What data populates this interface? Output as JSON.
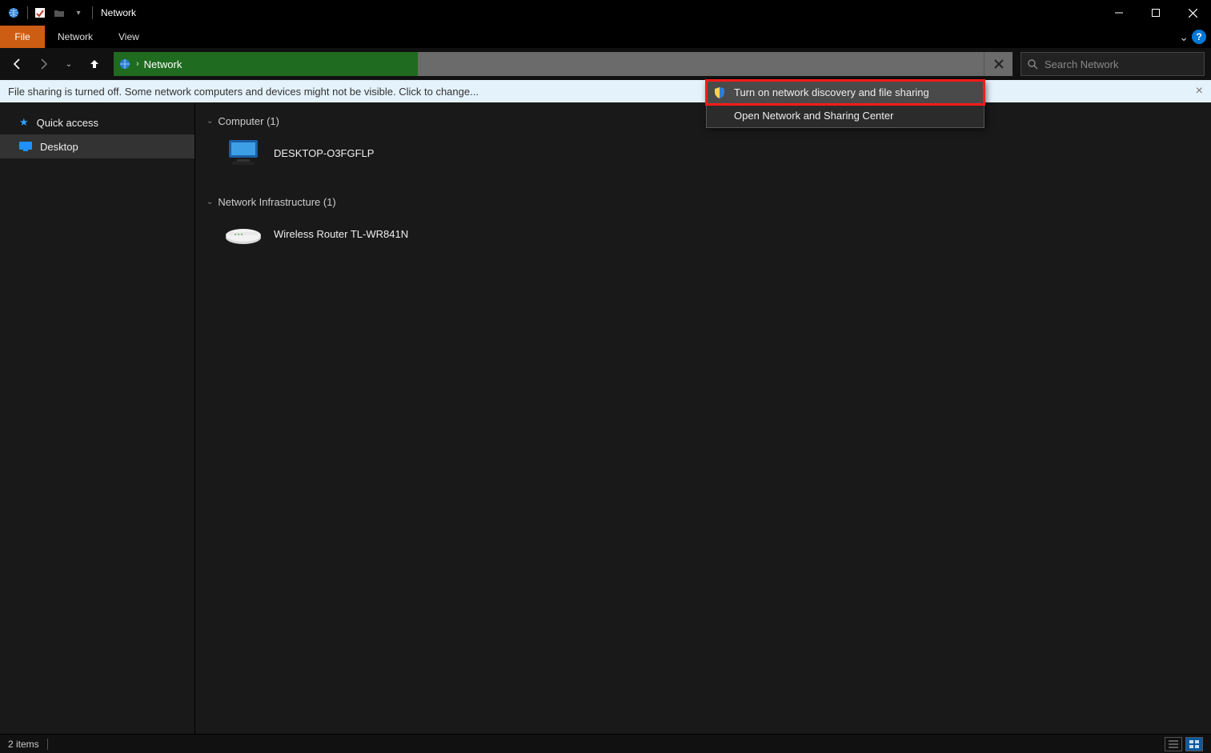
{
  "title": "Network",
  "ribbon": {
    "file": "File",
    "tabs": [
      "Network",
      "View"
    ]
  },
  "nav": {
    "breadcrumb": "Network",
    "search_placeholder": "Search Network"
  },
  "infobar": {
    "message": "File sharing is turned off. Some network computers and devices might not be visible. Click to change..."
  },
  "sidebar": {
    "items": [
      {
        "label": "Quick access",
        "icon": "star"
      },
      {
        "label": "Desktop",
        "icon": "desktop",
        "selected": true
      }
    ]
  },
  "context_menu": {
    "items": [
      {
        "label": "Turn on network discovery and file sharing",
        "highlighted": true,
        "shield": true
      },
      {
        "label": "Open Network and Sharing Center"
      }
    ]
  },
  "content": {
    "groups": [
      {
        "header": "Computer (1)",
        "items": [
          {
            "label": "DESKTOP-O3FGFLP",
            "icon": "computer"
          }
        ]
      },
      {
        "header": "Network Infrastructure (1)",
        "items": [
          {
            "label": "Wireless Router TL-WR841N",
            "icon": "router"
          }
        ]
      }
    ]
  },
  "status": {
    "text": "2 items"
  }
}
